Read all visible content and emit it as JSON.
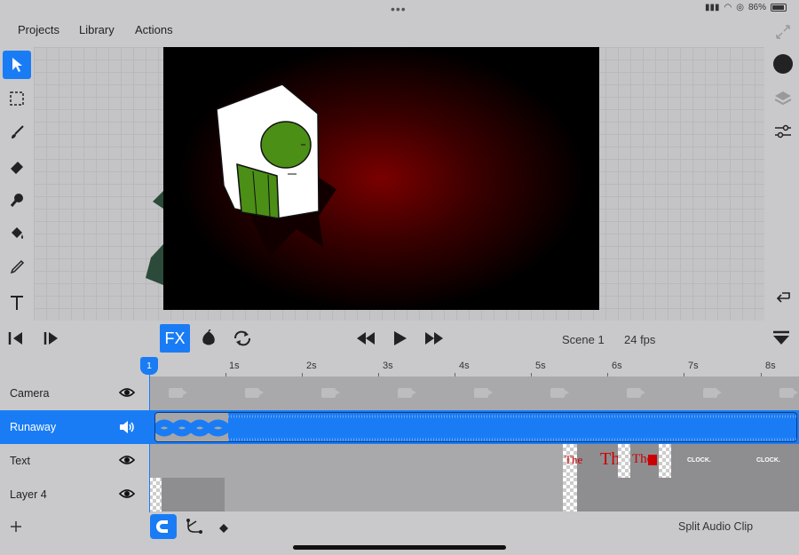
{
  "status": {
    "battery_text": "86%",
    "battery_level": 0.86
  },
  "menu": {
    "projects": "Projects",
    "library": "Library",
    "actions": "Actions"
  },
  "tools": [
    "select-tool",
    "marquee-tool",
    "brush-tool",
    "eraser-tool",
    "smudge-tool",
    "fill-tool",
    "eyedropper-tool",
    "text-tool"
  ],
  "playback": {
    "fx": "FX",
    "scene": "Scene 1",
    "fps": "24 fps"
  },
  "timeline": {
    "playhead_frame": "1",
    "ruler": [
      "1s",
      "2s",
      "3s",
      "4s",
      "5s",
      "6s",
      "7s",
      "8s"
    ],
    "tracks": [
      {
        "name": "Camera",
        "icon": "eye-icon"
      },
      {
        "name": "Runaway",
        "icon": "speaker-icon",
        "selected": true
      },
      {
        "name": "Text",
        "icon": "eye-icon"
      },
      {
        "name": "Layer 4",
        "icon": "eye-icon"
      }
    ],
    "text_frames": [
      "The",
      "The",
      "The",
      "CLOCK.",
      "CLOCK."
    ]
  },
  "bottom": {
    "split_audio": "Split Audio Clip"
  },
  "colors": {
    "accent": "#1a7cf5",
    "current_color": "#222222"
  }
}
